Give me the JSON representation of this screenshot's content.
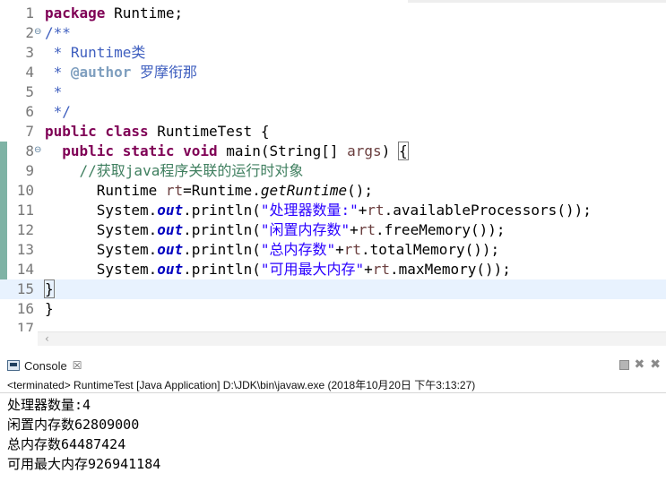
{
  "editor": {
    "lines": [
      {
        "num": "1"
      },
      {
        "num": "2"
      },
      {
        "num": "3"
      },
      {
        "num": "4"
      },
      {
        "num": "5"
      },
      {
        "num": "6"
      },
      {
        "num": "7"
      },
      {
        "num": "8"
      },
      {
        "num": "9"
      },
      {
        "num": "10"
      },
      {
        "num": "11"
      },
      {
        "num": "12"
      },
      {
        "num": "13"
      },
      {
        "num": "14"
      },
      {
        "num": "15"
      },
      {
        "num": "16"
      },
      {
        "num": "17"
      }
    ],
    "code": {
      "l1_kw": "package",
      "l1_rest": " Runtime;",
      "l2": "/**",
      "l3": " * Runtime类",
      "l4_pre": " * ",
      "l4_tag": "@author",
      "l4_rest": " 罗摩衔那",
      "l5": " *",
      "l6": " */",
      "l7_kw": "public class",
      "l7_rest": " RuntimeTest {",
      "l8_indent": "  ",
      "l8_kw": "public static void",
      "l8_mid": " main(String[] ",
      "l8_var": "args",
      "l8_end": ") ",
      "l8_brace": "{",
      "l9": "    //获取java程序关联的运行时对象",
      "l10_a": "      Runtime ",
      "l10_var": "rt",
      "l10_b": "=Runtime.",
      "l10_m": "getRuntime",
      "l10_c": "();",
      "sys": "      System.",
      "out": "out",
      "println": ".println(",
      "l11_str": "\"处理器数量:\"",
      "l11_a": "+",
      "l11_var": "rt",
      "l11_b": ".availableProcessors());",
      "l12_str": "\"闲置内存数\"",
      "l12_a": "+",
      "l12_var": "rt",
      "l12_b": ".freeMemory());",
      "l13_str": "\"总内存数\"",
      "l13_a": "+",
      "l13_var": "rt",
      "l13_b": ".totalMemory());",
      "l14_str": "\"可用最大内存\"",
      "l14_a": "+",
      "l14_var": "rt",
      "l14_b": ".maxMemory());",
      "l15": "}",
      "l16": "}"
    },
    "fold_glyph": "⊖"
  },
  "scrollbar": {
    "left_arrow": "‹"
  },
  "console": {
    "tab_label": "Console",
    "close_glyph": "☒",
    "status": "<terminated> RuntimeTest [Java Application] D:\\JDK\\bin\\javaw.exe (2018年10月20日 下午3:13:27)",
    "output": [
      "处理器数量:4",
      "闲置内存数62809000",
      "总内存数64487424",
      "可用最大内存926941184"
    ],
    "toolbar": {
      "remove_all": "✖",
      "remove_launch": "✖"
    }
  },
  "colors": {
    "keyword": "#7f0055",
    "comment": "#3f7f5f",
    "javadoc": "#3f5fbf",
    "string": "#2a00ff",
    "field": "#0000c0",
    "local_var": "#6a3e3e",
    "current_line": "#e8f2fe",
    "line_number": "#787878"
  }
}
